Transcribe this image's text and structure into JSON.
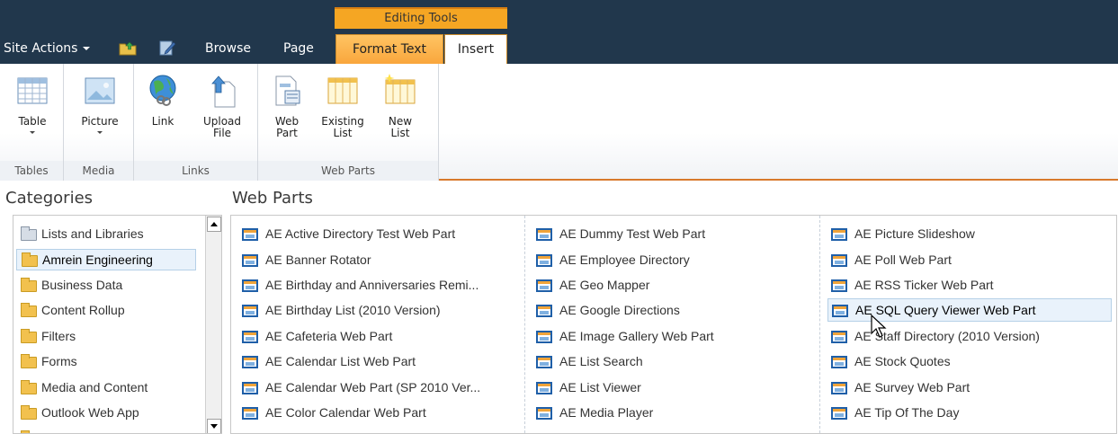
{
  "topbar": {
    "site_actions": "Site Actions",
    "tabs": {
      "browse": "Browse",
      "page": "Page",
      "format_text": "Format Text",
      "insert": "Insert"
    },
    "context_group": "Editing Tools"
  },
  "ribbon": {
    "groups": {
      "tables": {
        "label": "Tables",
        "buttons": [
          "Table"
        ]
      },
      "media": {
        "label": "Media",
        "buttons": [
          "Picture"
        ]
      },
      "links": {
        "label": "Links",
        "buttons": [
          "Link",
          "Upload",
          "File"
        ]
      },
      "web_parts": {
        "label": "Web Parts",
        "buttons": [
          "Web",
          "Part",
          "Existing",
          "List",
          "New",
          "List"
        ]
      }
    }
  },
  "categories": {
    "heading": "Categories",
    "items": [
      "Lists and Libraries",
      "Amrein Engineering",
      "Business Data",
      "Content Rollup",
      "Filters",
      "Forms",
      "Media and Content",
      "Outlook Web App"
    ],
    "selected_index": 1
  },
  "web_parts": {
    "heading": "Web Parts",
    "columns": [
      [
        "AE Active Directory Test Web Part",
        "AE Banner Rotator",
        "AE Birthday and Anniversaries Remi...",
        "AE Birthday List (2010 Version)",
        "AE Cafeteria Web Part",
        "AE Calendar List Web Part",
        "AE Calendar Web Part (SP 2010 Ver...",
        "AE Color Calendar Web Part"
      ],
      [
        "AE Dummy Test Web Part",
        "AE Employee Directory",
        "AE Geo Mapper",
        "AE Google Directions",
        "AE Image Gallery Web Part",
        "AE List Search",
        "AE List Viewer",
        "AE Media Player"
      ],
      [
        "AE Picture Slideshow",
        "AE Poll Web Part",
        "AE RSS Ticker Web Part",
        "AE SQL Query Viewer Web Part",
        "AE Staff Directory (2010 Version)",
        "AE Stock Quotes",
        "AE Survey Web Part",
        "AE Tip Of The Day"
      ]
    ],
    "selected": "AE SQL Query Viewer Web Part"
  }
}
